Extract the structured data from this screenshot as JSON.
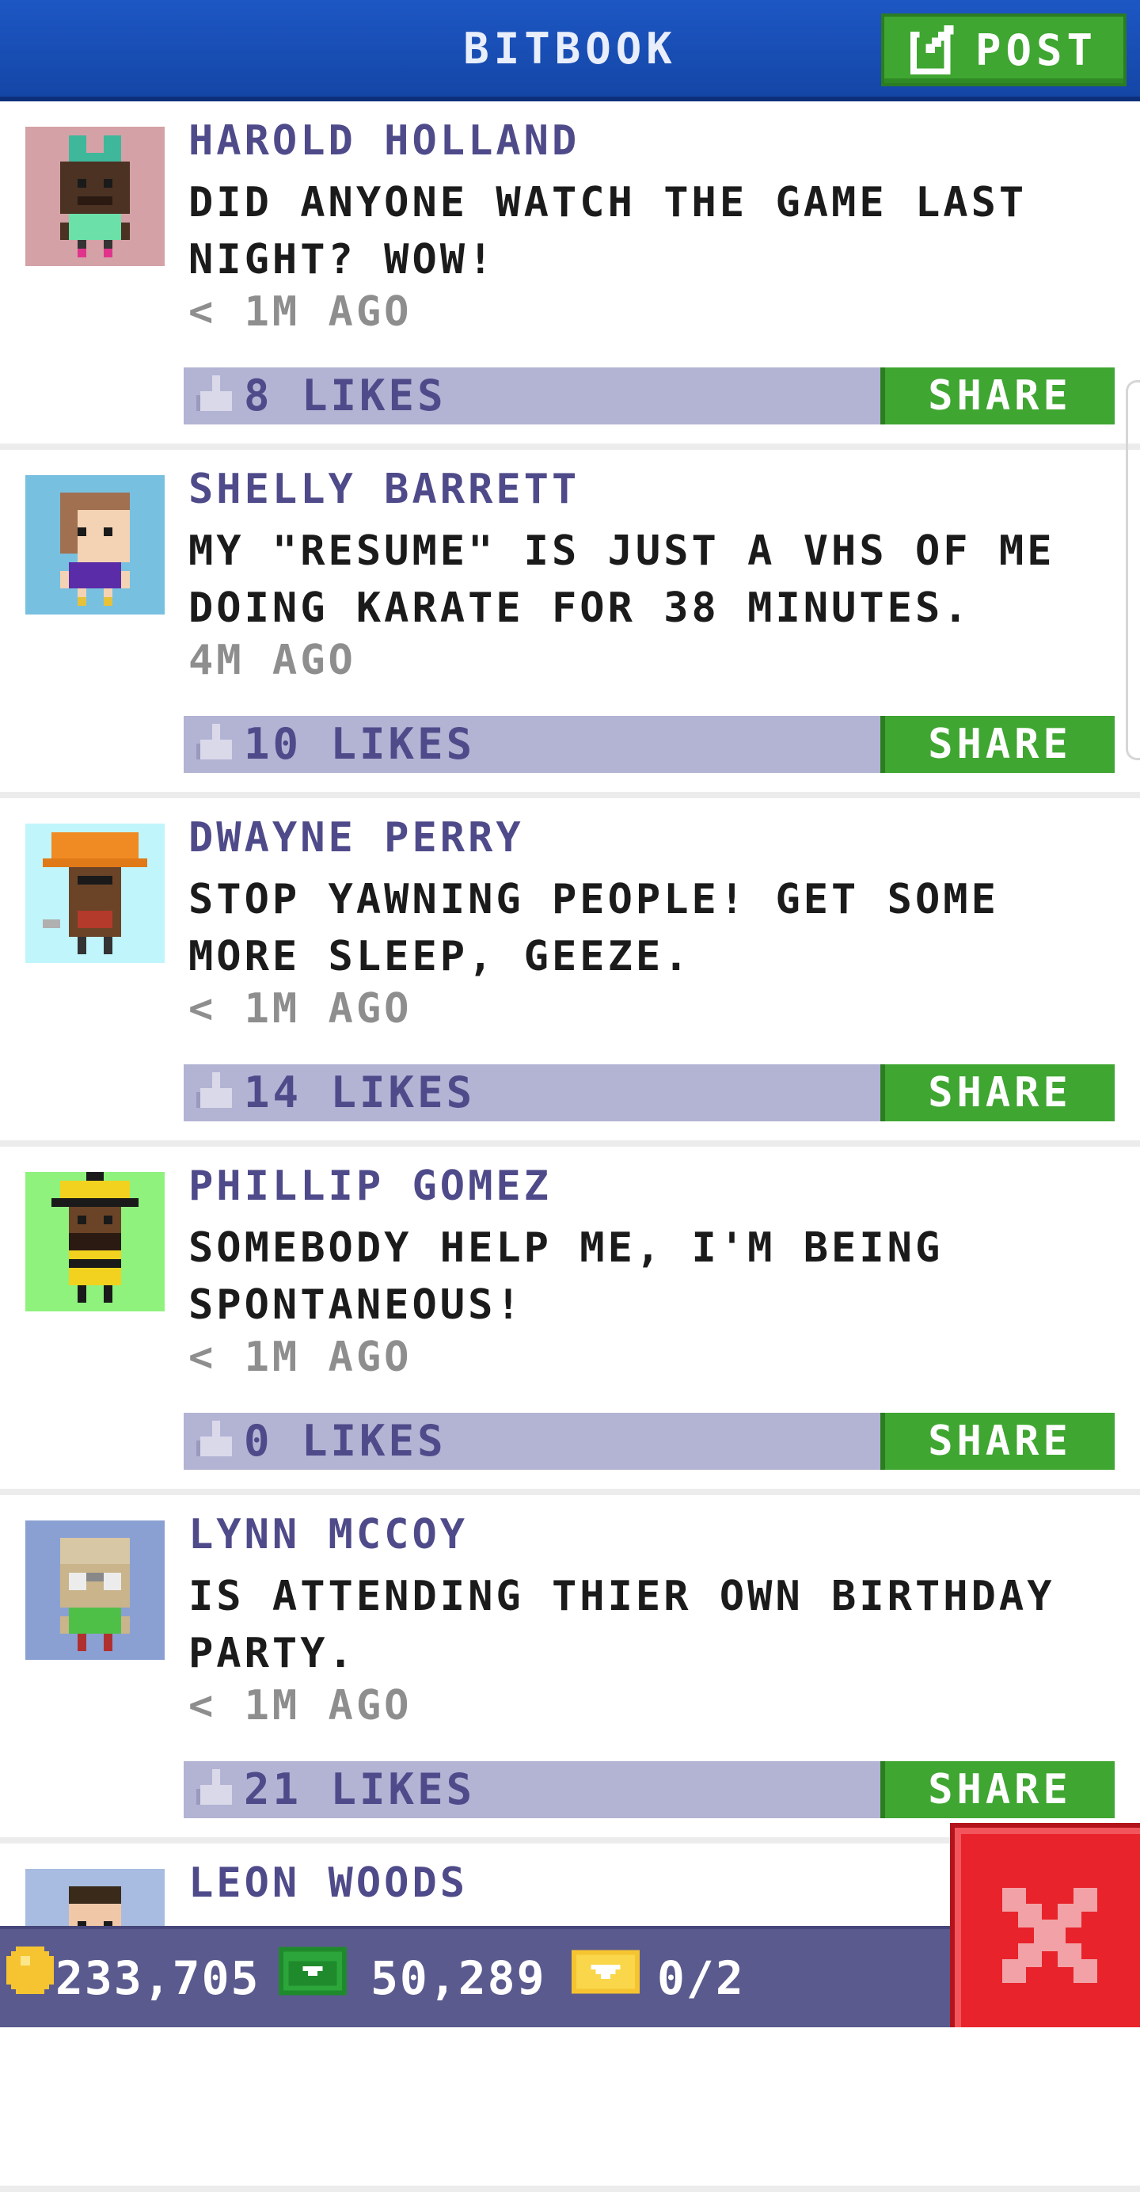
{
  "header": {
    "title": "BITBOOK",
    "post_label": "POST"
  },
  "posts": [
    {
      "author": "HAROLD HOLLAND",
      "message": "DID ANYONE WATCH THE GAME LAST NIGHT? WOW!",
      "time": "< 1M AGO",
      "likes": "8 LIKES",
      "share_label": "SHARE",
      "avatar_bg": "#d4a2a6"
    },
    {
      "author": "SHELLY BARRETT",
      "message": "MY \"RESUME\" IS JUST A VHS OF ME DOING KARATE FOR 38 MINUTES.",
      "time": "4M AGO",
      "likes": "10 LIKES",
      "share_label": "SHARE",
      "avatar_bg": "#78c0df"
    },
    {
      "author": "DWAYNE PERRY",
      "message": "STOP YAWNING PEOPLE! GET SOME MORE SLEEP, GEEZE.",
      "time": "< 1M AGO",
      "likes": "14 LIKES",
      "share_label": "SHARE",
      "avatar_bg": "#bff5fb"
    },
    {
      "author": "PHILLIP GOMEZ",
      "message": "SOMEBODY HELP ME, I'M BEING SPONTANEOUS!",
      "time": "< 1M AGO",
      "likes": "0 LIKES",
      "share_label": "SHARE",
      "avatar_bg": "#8ef27d"
    },
    {
      "author": "LYNN MCCOY",
      "message": "IS ATTENDING THIER OWN BIRTHDAY PARTY.",
      "time": "< 1M AGO",
      "likes": "21 LIKES",
      "share_label": "SHARE",
      "avatar_bg": "#8aa0d3"
    },
    {
      "author": "LEON WOODS",
      "message": "",
      "time": "",
      "likes": "",
      "share_label": "",
      "avatar_bg": "#a7bce0"
    }
  ],
  "stats": {
    "coins": "233,705",
    "bux": "50,289",
    "tickets": "0/2"
  },
  "colors": {
    "header_blue": "#1a4fb8",
    "button_green": "#3fa631",
    "like_bar": "#b3b3d4",
    "name_purple": "#4f4b8a",
    "close_red": "#e8232b",
    "bottom_bar": "#5a5a8e"
  },
  "icons": {
    "post": "edit-icon",
    "like": "thumbs-up-icon",
    "coin": "coin-icon",
    "bux": "bux-icon",
    "ticket": "ticket-icon",
    "close": "close-icon"
  }
}
